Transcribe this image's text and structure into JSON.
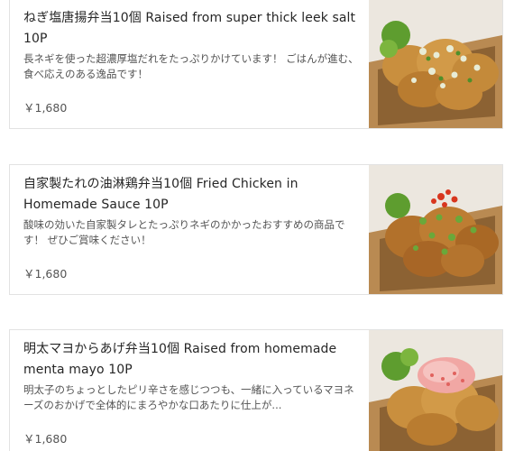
{
  "menu_items": [
    {
      "title": "ねぎ塩唐揚弁当10個 Raised from super thick leek salt 10P",
      "description": "長ネギを使った超濃厚塩だれをたっぷりかけています！ ごはんが進む、食べ応えのある逸品です！",
      "price": "￥1,680",
      "image_icon": "leek-salt-karaage-photo"
    },
    {
      "title": "自家製たれの油淋鶏弁当10個 Fried Chicken in Homemade Sauce 10P",
      "description": "酸味の効いた自家製タレとたっぷりネギのかかったおすすめの商品です！ ぜひご賞味ください！",
      "price": "￥1,680",
      "image_icon": "fried-chicken-sauce-photo"
    },
    {
      "title": "明太マヨからあげ弁当10個 Raised from homemade menta mayo 10P",
      "description": "明太子のちょっとしたピリ辛さを感じつつも、一緒に入っているマヨネーズのおかげで全体的にまろやかな口あたりに仕上が...",
      "price": "￥1,680",
      "image_icon": "mentai-mayo-karaage-photo"
    }
  ],
  "colors": {
    "border": "#e2e2e2",
    "text_primary": "#262626",
    "text_secondary": "#545454"
  }
}
